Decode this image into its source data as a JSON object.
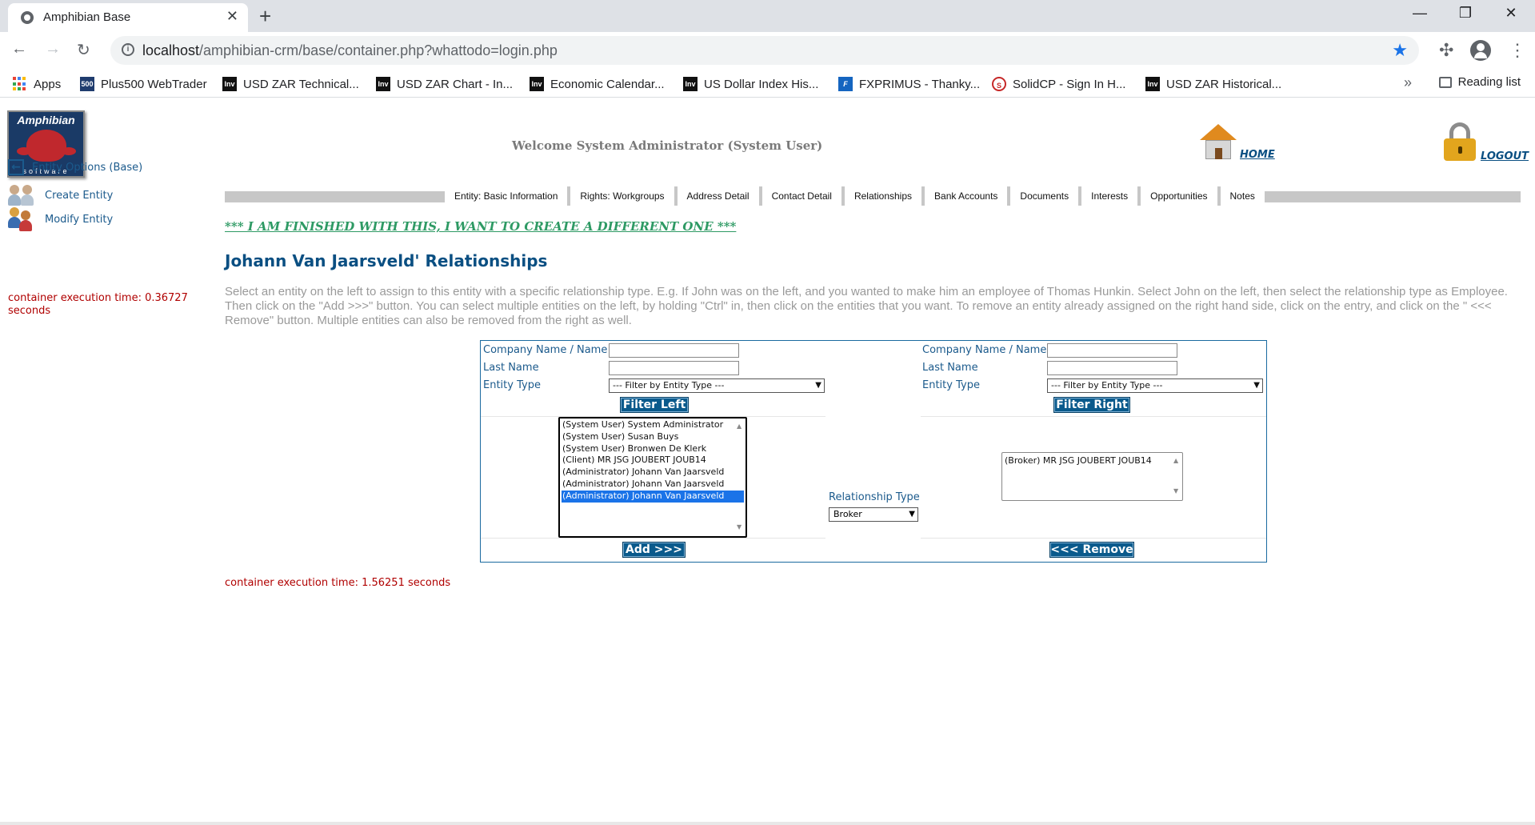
{
  "browser": {
    "tab_title": "Amphibian Base",
    "url_host": "localhost",
    "url_path": "/amphibian-crm/base/container.php?whattodo=login.php",
    "bookmarks": [
      {
        "label": "Apps",
        "icon": "apps-grid-icon"
      },
      {
        "label": "Plus500 WebTrader",
        "icon": "plus500-icon"
      },
      {
        "label": "USD ZAR Technical...",
        "icon": "investing-icon"
      },
      {
        "label": "USD ZAR Chart - In...",
        "icon": "investing-icon"
      },
      {
        "label": "Economic Calendar...",
        "icon": "investing-icon"
      },
      {
        "label": "US Dollar Index His...",
        "icon": "investing-icon"
      },
      {
        "label": "FXPRIMUS - Thanky...",
        "icon": "fxprimus-icon"
      },
      {
        "label": "SolidCP - Sign In H...",
        "icon": "solidcp-icon"
      },
      {
        "label": "USD ZAR Historical...",
        "icon": "investing-icon"
      }
    ],
    "reading_list": "Reading list",
    "accent": "#1a73e8"
  },
  "header": {
    "logo_text": "Amphibian",
    "logo_subtext": "software",
    "welcome": "Welcome System Administrator (System User)",
    "home_label": "HOME",
    "logout_label": "LOGOUT"
  },
  "left_menu": {
    "items": [
      {
        "label": "Entity Options (Base)",
        "icon": "back-arrow-icon"
      },
      {
        "label": "Create Entity",
        "icon": "people-add-icon"
      },
      {
        "label": "Modify Entity",
        "icon": "people-edit-icon"
      }
    ],
    "exec_time": "container execution time: 0.36727 seconds"
  },
  "tabs": [
    "Entity: Basic Information",
    "Rights: Workgroups",
    "Address Detail",
    "Contact Detail",
    "Relationships",
    "Bank Accounts",
    "Documents",
    "Interests",
    "Opportunities",
    "Notes"
  ],
  "finished_link": "*** I AM FINISHED WITH THIS, I WANT TO CREATE A DIFFERENT ONE ***",
  "heading": "Johann Van Jaarsveld' Relationships",
  "instructions": "Select an entity on the left to assign to this entity with a specific relationship type. E.g. If John was on the left, and you wanted to make him an employee of Thomas Hunkin. Select John on the left, then select the relationship type as Employee. Then click on the \"Add >>>\" button. You can select multiple entities on the left, by holding \"Ctrl\" in, then click on the entities that you want. To remove an entity already assigned on the right hand side, click on the entry, and click on the \" <<< Remove\" button. Multiple entities can also be removed from the right as well.",
  "left_filter": {
    "company_label": "Company Name / Name",
    "company_value": "",
    "lastname_label": "Last Name",
    "lastname_value": "",
    "type_label": "Entity Type",
    "type_value": "--- Filter by Entity Type ---",
    "button": "Filter Left"
  },
  "right_filter": {
    "company_label": "Company Name / Name",
    "company_value": "",
    "lastname_label": "Last Name",
    "lastname_value": "",
    "type_label": "Entity Type",
    "type_value": "--- Filter by Entity Type ---",
    "button": "Filter Right"
  },
  "left_list": [
    {
      "label": "(System User) System Administrator",
      "selected": false
    },
    {
      "label": "(System User) Susan Buys",
      "selected": false
    },
    {
      "label": "(System User) Bronwen De Klerk",
      "selected": false
    },
    {
      "label": "(Client) MR JSG JOUBERT JOUB14",
      "selected": false
    },
    {
      "label": "(Administrator) Johann Van Jaarsveld",
      "selected": false
    },
    {
      "label": "(Administrator) Johann Van Jaarsveld",
      "selected": false
    },
    {
      "label": "(Administrator) Johann Van Jaarsveld",
      "selected": true
    }
  ],
  "right_list": [
    {
      "label": "(Broker) MR JSG JOUBERT JOUB14",
      "selected": false
    }
  ],
  "relationship": {
    "label": "Relationship Type",
    "value": "Broker"
  },
  "add_button": "Add >>>",
  "remove_button": "<<< Remove",
  "exec_time_bottom": "container execution time: 1.56251 seconds"
}
